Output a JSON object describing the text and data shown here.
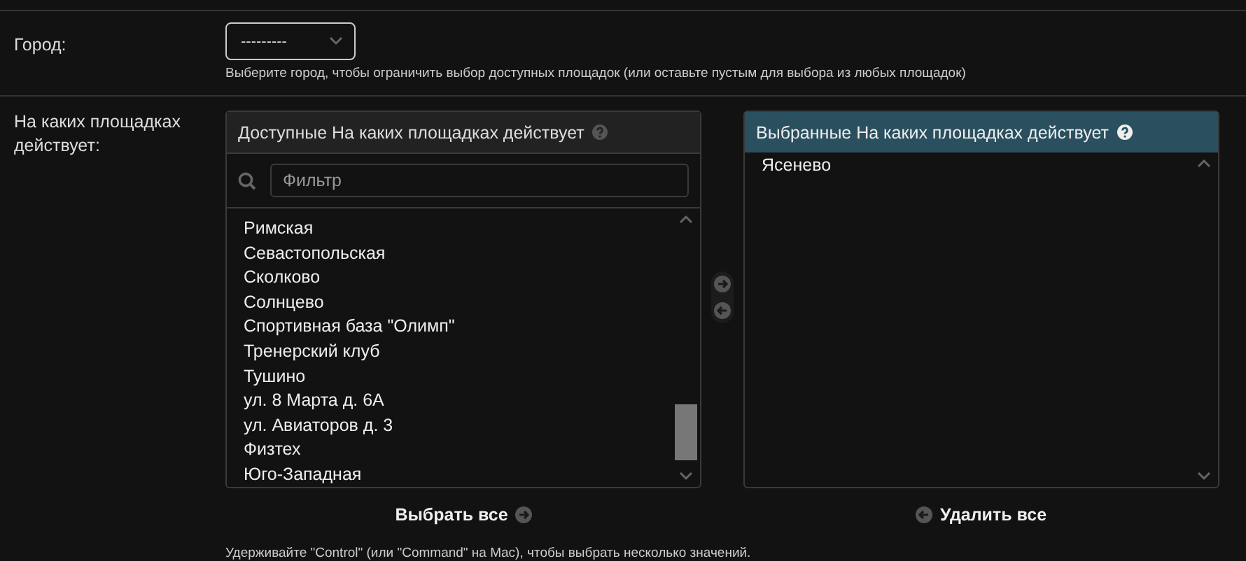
{
  "city": {
    "label": "Город:",
    "select": {
      "value": "---------"
    },
    "help": "Выберите город, чтобы ограничить выбор доступных площадок (или оставьте пустым для выбора из любых площадок)"
  },
  "venues": {
    "label": "На каких площадках действует:",
    "available": {
      "title": "Доступные На каких площадках действует",
      "filter": {
        "placeholder": "Фильтр"
      },
      "items": [
        {
          "label": "Римская"
        },
        {
          "label": "Севастопольская"
        },
        {
          "label": "Сколково"
        },
        {
          "label": "Солнцево"
        },
        {
          "label": "Спортивная база \"Олимп\""
        },
        {
          "label": "Тренерский клуб"
        },
        {
          "label": "Тушино"
        },
        {
          "label": "ул. 8 Марта д. 6А"
        },
        {
          "label": "ул. Авиаторов д. 3"
        },
        {
          "label": "Физтех"
        },
        {
          "label": "Юго-Западная"
        }
      ],
      "action": "Выбрать все"
    },
    "chosen": {
      "title": "Выбранные На каких площадках действует",
      "items": [
        {
          "label": "Ясенево"
        }
      ],
      "action": "Удалить все"
    },
    "help": "Удерживайте \"Control\" (или \"Command\" на Mac), чтобы выбрать несколько значений."
  }
}
